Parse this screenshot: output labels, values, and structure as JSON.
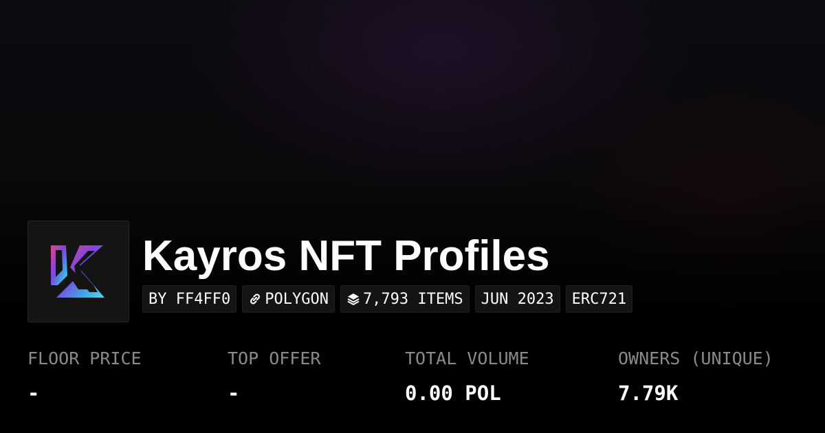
{
  "collection": {
    "name": "Kayros NFT Profiles",
    "logo_icon": "kayros-k-logo",
    "logo_colors": [
      "#e8408e",
      "#7b47e0",
      "#3fa8e4",
      "#5ad2f0"
    ]
  },
  "chips": [
    {
      "label": "BY FF4FF0",
      "icon": null
    },
    {
      "label": "POLYGON",
      "icon": "chain-link-icon"
    },
    {
      "label": "7,793 ITEMS",
      "icon": "layers-icon"
    },
    {
      "label": "JUN 2023",
      "icon": null
    },
    {
      "label": "ERC721",
      "icon": null
    }
  ],
  "stats": [
    {
      "label": "FLOOR PRICE",
      "value": "-"
    },
    {
      "label": "TOP OFFER",
      "value": "-"
    },
    {
      "label": "TOTAL VOLUME",
      "value": "0.00 POL"
    },
    {
      "label": "OWNERS (UNIQUE)",
      "value": "7.79K"
    }
  ],
  "colors": {
    "background": "#000000",
    "text_primary": "#ffffff",
    "text_muted": "#8a8a8a",
    "chip_background": "#141414"
  }
}
